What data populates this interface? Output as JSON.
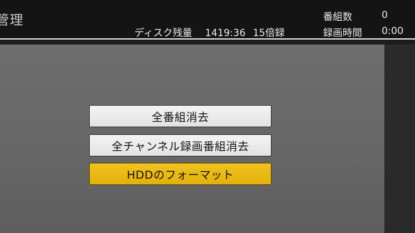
{
  "header": {
    "title": "管理",
    "disk": {
      "label": "ディスク残量",
      "time": "1419:36",
      "mode": "15倍録"
    },
    "program_count": {
      "label": "番組数",
      "value": "0"
    },
    "record_time": {
      "label": "録画時間",
      "value": "0:00"
    }
  },
  "menu": {
    "items": [
      {
        "label": "全番組消去",
        "selected": false
      },
      {
        "label": "全チャンネル録画番組消去",
        "selected": false
      },
      {
        "label": "HDDのフォーマット",
        "selected": true
      }
    ]
  },
  "colors": {
    "selected_accent": "#f0c21e",
    "button_bg": "#eeeeee",
    "panel_bg": "#6b6b6b",
    "header_bg": "#141414"
  }
}
